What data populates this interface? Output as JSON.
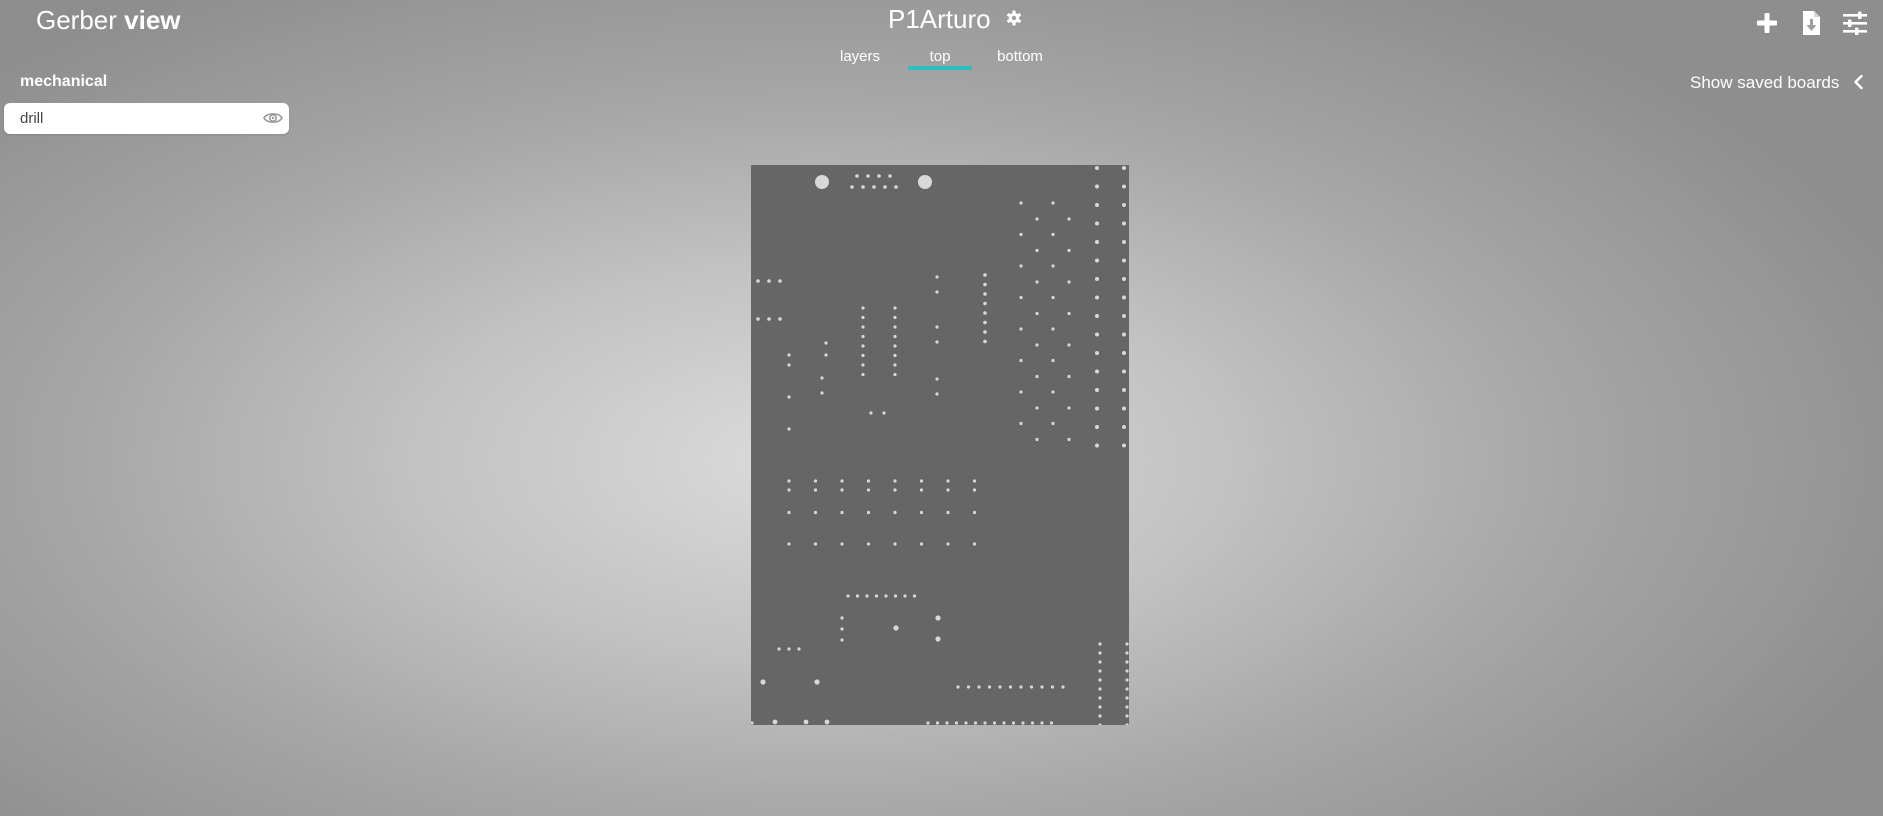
{
  "app": {
    "logo_regular": "Gerber ",
    "logo_bold": "view"
  },
  "board": {
    "title": "P1Arturo",
    "settings_icon": "gear-icon"
  },
  "tabs": [
    {
      "label": "layers",
      "active": false
    },
    {
      "label": "top",
      "active": true
    },
    {
      "label": "bottom",
      "active": false
    }
  ],
  "toolbar": {
    "icons": [
      "plus-icon",
      "download-icon",
      "sliders-icon"
    ]
  },
  "sidebar": {
    "section_title": "mechanical",
    "layers": [
      {
        "name": "drill",
        "visible": true,
        "icon": "eye-icon"
      }
    ]
  },
  "saved_boards": {
    "label": "Show saved boards",
    "icon": "chevron-left-icon"
  },
  "colors": {
    "accent": "#2bbfc1",
    "board_fill": "#666666",
    "drill_hole": "#d8d8d8"
  }
}
